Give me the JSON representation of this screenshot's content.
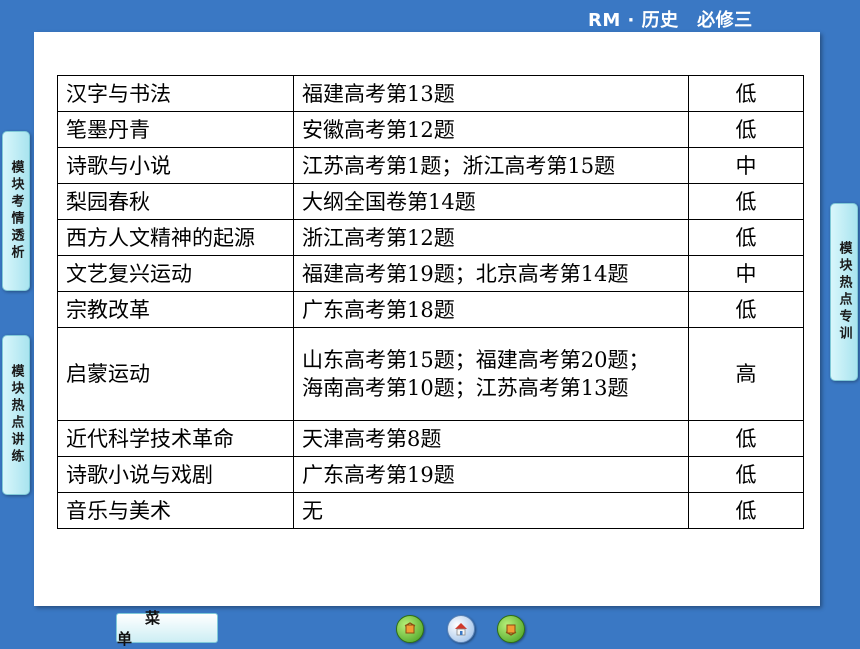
{
  "header": {
    "title": "RM · 历史　必修三"
  },
  "left_tabs": [
    {
      "label": "模块考情透析"
    },
    {
      "label": "模块热点讲练"
    }
  ],
  "right_tabs": [
    {
      "label": "模块热点专训"
    }
  ],
  "table": {
    "rows": [
      {
        "topic": "汉字与书法",
        "exam": "福建高考第13题",
        "level": "低"
      },
      {
        "topic": "笔墨丹青",
        "exam": "安徽高考第12题",
        "level": "低"
      },
      {
        "topic": "诗歌与小说",
        "exam": "江苏高考第1题；浙江高考第15题",
        "level": "中"
      },
      {
        "topic": "梨园春秋",
        "exam": "大纲全国卷第14题",
        "level": "低"
      },
      {
        "topic": "西方人文精神的起源",
        "exam": "浙江高考第12题",
        "level": "低"
      },
      {
        "topic": "文艺复兴运动",
        "exam": "福建高考第19题；北京高考第14题",
        "level": "中"
      },
      {
        "topic": "宗教改革",
        "exam": "广东高考第18题",
        "level": "低"
      },
      {
        "topic": "启蒙运动",
        "exam": "山东高考第15题；福建高考第20题；",
        "exam2": "海南高考第10题；江苏高考第13题",
        "level": "高"
      },
      {
        "topic": "近代科学技术革命",
        "exam": "天津高考第8题",
        "level": "低"
      },
      {
        "topic": "诗歌小说与戏剧",
        "exam": "广东高考第19题",
        "level": "低"
      },
      {
        "topic": "音乐与美术",
        "exam": "无",
        "level": "低"
      }
    ]
  },
  "footer": {
    "menu_label": "菜单",
    "nav_icons": [
      "previous-page-icon",
      "home-icon",
      "next-page-icon"
    ]
  },
  "colors": {
    "background": "#3a78c4",
    "panel": "#ffffff",
    "tab": "#c4eef6",
    "nav_green": "#4caf22"
  }
}
